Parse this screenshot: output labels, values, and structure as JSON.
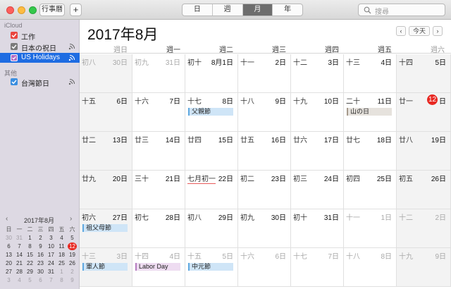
{
  "toolbar": {
    "calendars_label": "行事曆",
    "add_label": "+",
    "views": [
      "日",
      "週",
      "月",
      "年"
    ],
    "active_view": 2,
    "search_placeholder": "搜尋"
  },
  "sidebar": {
    "group1": "iCloud",
    "group2": "其他",
    "items": [
      {
        "label": "工作",
        "color": "#e9463f",
        "checked": true
      },
      {
        "label": "日本の祝日",
        "color": "#7a7a7a",
        "checked": true,
        "shared": true
      },
      {
        "label": "US Holidays",
        "color": "#b46ec5",
        "checked": true,
        "shared": true,
        "selected": true
      },
      {
        "label": "台灣節日",
        "color": "#3a8ee0",
        "checked": true,
        "shared": true
      }
    ]
  },
  "mini_calendar": {
    "title": "2017年8月",
    "prev": "‹",
    "next": "›",
    "weekdays": [
      "日",
      "一",
      "二",
      "三",
      "四",
      "五",
      "六"
    ],
    "rows": [
      [
        "30",
        "31",
        "1",
        "2",
        "3",
        "4",
        "5"
      ],
      [
        "6",
        "7",
        "8",
        "9",
        "10",
        "11",
        "12"
      ],
      [
        "13",
        "14",
        "15",
        "16",
        "17",
        "18",
        "19"
      ],
      [
        "20",
        "21",
        "22",
        "23",
        "24",
        "25",
        "26"
      ],
      [
        "27",
        "28",
        "29",
        "30",
        "31",
        "1",
        "2"
      ],
      [
        "3",
        "4",
        "5",
        "6",
        "7",
        "8",
        "9"
      ]
    ],
    "today": "12"
  },
  "main": {
    "title": "2017年8月",
    "prev": "‹",
    "today": "今天",
    "next": "›",
    "weekdays": [
      "週日",
      "週一",
      "週二",
      "週三",
      "週四",
      "週五",
      "週六"
    ],
    "weeks": [
      [
        {
          "lunar": "初八",
          "day": "30日",
          "out": true
        },
        {
          "lunar": "初九",
          "day": "31日",
          "out": true
        },
        {
          "lunar": "初十",
          "day": "8月1日"
        },
        {
          "lunar": "十一",
          "day": "2日"
        },
        {
          "lunar": "十二",
          "day": "3日"
        },
        {
          "lunar": "十三",
          "day": "4日"
        },
        {
          "lunar": "十四",
          "day": "5日"
        }
      ],
      [
        {
          "lunar": "十五",
          "day": "6日"
        },
        {
          "lunar": "十六",
          "day": "7日"
        },
        {
          "lunar": "十七",
          "day": "8日",
          "event": "父親節",
          "event_style": "blue"
        },
        {
          "lunar": "十八",
          "day": "9日"
        },
        {
          "lunar": "十九",
          "day": "10日"
        },
        {
          "lunar": "二十",
          "day": "11日",
          "event": "山の日",
          "event_style": "brown"
        },
        {
          "lunar": "廿一",
          "day": "12",
          "suffix": "日",
          "today": true
        }
      ],
      [
        {
          "lunar": "廿二",
          "day": "13日"
        },
        {
          "lunar": "廿三",
          "day": "14日"
        },
        {
          "lunar": "廿四",
          "day": "15日"
        },
        {
          "lunar": "廿五",
          "day": "16日"
        },
        {
          "lunar": "廿六",
          "day": "17日"
        },
        {
          "lunar": "廿七",
          "day": "18日"
        },
        {
          "lunar": "廿八",
          "day": "19日"
        }
      ],
      [
        {
          "lunar": "廿九",
          "day": "20日"
        },
        {
          "lunar": "三十",
          "day": "21日"
        },
        {
          "lunar": "七月初一",
          "day": "22日",
          "lunar_mark": true
        },
        {
          "lunar": "初二",
          "day": "23日"
        },
        {
          "lunar": "初三",
          "day": "24日"
        },
        {
          "lunar": "初四",
          "day": "25日"
        },
        {
          "lunar": "初五",
          "day": "26日"
        }
      ],
      [
        {
          "lunar": "初六",
          "day": "27日",
          "event": "祖父母節",
          "event_style": "blue"
        },
        {
          "lunar": "初七",
          "day": "28日"
        },
        {
          "lunar": "初八",
          "day": "29日"
        },
        {
          "lunar": "初九",
          "day": "30日"
        },
        {
          "lunar": "初十",
          "day": "31日"
        },
        {
          "lunar": "十一",
          "day": "1日",
          "out": true
        },
        {
          "lunar": "十二",
          "day": "2日",
          "out": true
        }
      ],
      [
        {
          "lunar": "十三",
          "day": "3日",
          "out": true,
          "event": "軍人節",
          "event_style": "blue"
        },
        {
          "lunar": "十四",
          "day": "4日",
          "out": true,
          "event": "Labor Day",
          "event_style": "purple"
        },
        {
          "lunar": "十五",
          "day": "5日",
          "out": true,
          "event": "中元節",
          "event_style": "blue"
        },
        {
          "lunar": "十六",
          "day": "6日",
          "out": true
        },
        {
          "lunar": "十七",
          "day": "7日",
          "out": true
        },
        {
          "lunar": "十八",
          "day": "8日",
          "out": true
        },
        {
          "lunar": "十九",
          "day": "9日",
          "out": true
        }
      ]
    ]
  },
  "colors": {
    "accent": "#1e6ce2",
    "today": "#e82822"
  }
}
